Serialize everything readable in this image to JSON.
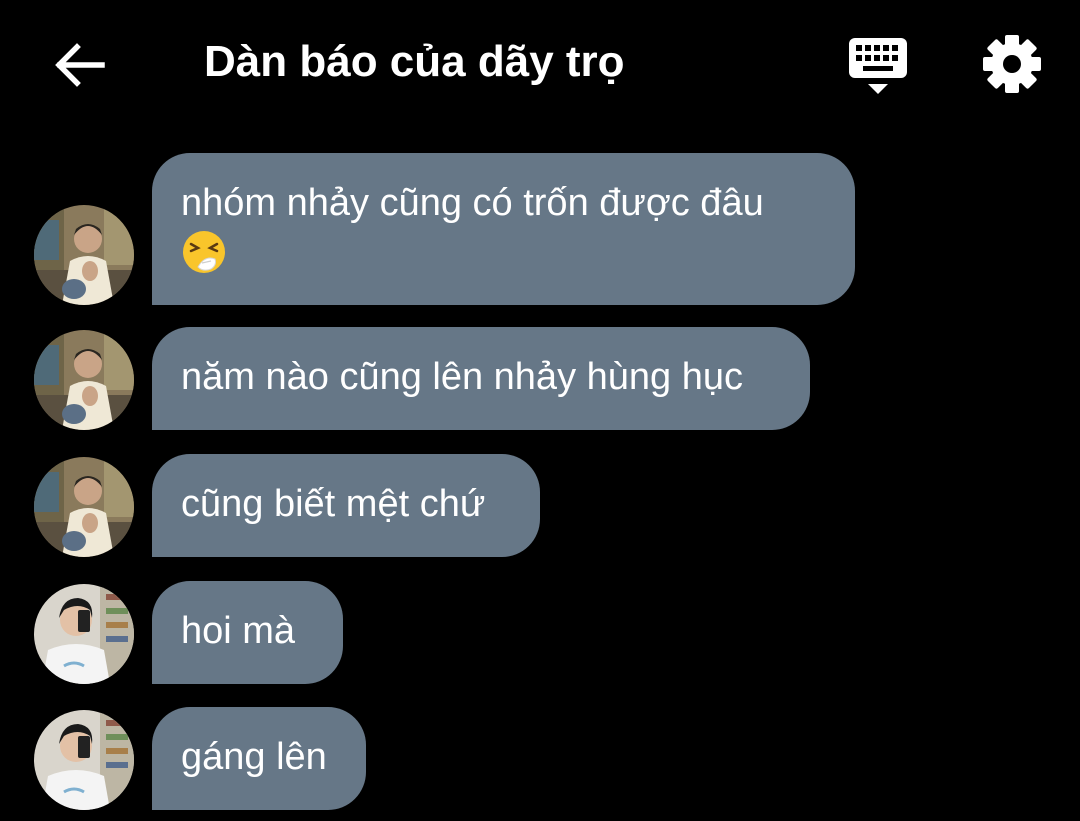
{
  "header": {
    "back_icon": "arrow-left-icon",
    "title": "Dàn báo của dãy trọ",
    "keyboard_icon": "keyboard-icon",
    "settings_icon": "gear-icon"
  },
  "messages": [
    {
      "text": "nhóm nhảy cũng có trốn được đâu",
      "emoji": "sneezing-face-emoji",
      "sender_avatar": "avatar-person-a"
    },
    {
      "text": "năm nào cũng lên nhảy hùng hục",
      "sender_avatar": "avatar-person-a"
    },
    {
      "text": "cũng biết mệt chứ",
      "sender_avatar": "avatar-person-a"
    },
    {
      "text": "hoi mà",
      "sender_avatar": "avatar-person-b"
    },
    {
      "text": "gáng lên",
      "sender_avatar": "avatar-person-b"
    }
  ],
  "colors": {
    "background": "#000000",
    "bubble": "#667787",
    "text": "#ffffff"
  }
}
